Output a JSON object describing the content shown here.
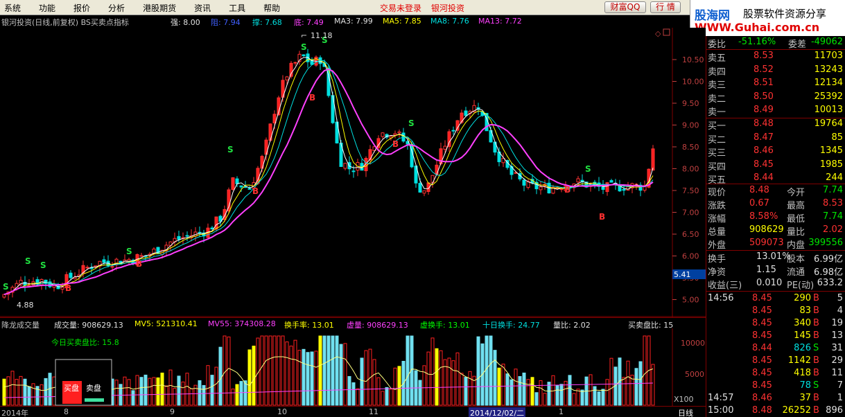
{
  "menu": [
    "系统",
    "功能",
    "报价",
    "分析",
    "港股期货",
    "资讯",
    "工具",
    "帮助"
  ],
  "center_status": [
    "交易未登录",
    "银河投资"
  ],
  "buttons": {
    "caifu": "财富QQ",
    "hangqing": "行 情"
  },
  "logo": {
    "line1": "股海网",
    "line1b": "股票软件资源分享",
    "line2": "WWW.Guhai.com.cn"
  },
  "header": {
    "title": "银河投资(日线,前复权) BS买卖点指标",
    "qiang": "强: 8.00",
    "zu": "阻: 7.94",
    "cheng": "撑: 7.68",
    "di": "底: 7.49",
    "ma3": "MA3: 7.99",
    "ma5": "MA5: 7.85",
    "ma8": "MA8: 7.76",
    "ma13": "MA13: 7.72"
  },
  "vol_header": {
    "name": "降龙成交量",
    "cjl": "成交量: 908629.13",
    "mv5": "MV5: 521310.41",
    "mv55": "MV55: 374308.28",
    "hsl": "换手率: 13.01",
    "xl": "虚量: 908629.13",
    "xhs": "虚换手: 13.01",
    "sr": "十日换手: 24.77",
    "lb": "量比: 2.02",
    "mmb": "买卖盘比: 15",
    "today": "今日买卖盘比: 15.8",
    "buy": "买盘",
    "sell": "卖盘"
  },
  "annotations": {
    "high": "11.18",
    "low": "4.88"
  },
  "y_ticks": [
    "10.50",
    "10.00",
    "9.50",
    "9.00",
    "8.50",
    "8.00",
    "7.50",
    "7.00",
    "6.50",
    "6.00",
    "5.50",
    "5.00"
  ],
  "y_current": "5.41",
  "vol_ticks": [
    "10000",
    "5000"
  ],
  "vol_unit": "X100",
  "x_labels": [
    "2014年",
    "8",
    "9",
    "10",
    "11",
    "2014/12/02/二",
    "1"
  ],
  "period": "日线",
  "quote": {
    "wb_label": "委比",
    "wb": "-51.16%",
    "wc_label": "委差",
    "wc": "-49062",
    "asks": [
      {
        "label": "卖五",
        "price": "8.53",
        "vol": "11703"
      },
      {
        "label": "卖四",
        "price": "8.52",
        "vol": "13243"
      },
      {
        "label": "卖三",
        "price": "8.51",
        "vol": "12134"
      },
      {
        "label": "卖二",
        "price": "8.50",
        "vol": "25392"
      },
      {
        "label": "卖一",
        "price": "8.49",
        "vol": "10013"
      }
    ],
    "bids": [
      {
        "label": "买一",
        "price": "8.48",
        "vol": "19764"
      },
      {
        "label": "买二",
        "price": "8.47",
        "vol": "85"
      },
      {
        "label": "买三",
        "price": "8.46",
        "vol": "1345"
      },
      {
        "label": "买四",
        "price": "8.45",
        "vol": "1985"
      },
      {
        "label": "买五",
        "price": "8.44",
        "vol": "244"
      }
    ],
    "stats": [
      {
        "l1": "现价",
        "v1": "8.48",
        "c1": "up",
        "l2": "今开",
        "v2": "7.74",
        "c2": "dn"
      },
      {
        "l1": "涨跌",
        "v1": "0.67",
        "c1": "up",
        "l2": "最高",
        "v2": "8.53",
        "c2": "up"
      },
      {
        "l1": "涨幅",
        "v1": "8.58%",
        "c1": "up",
        "l2": "最低",
        "v2": "7.74",
        "c2": "dn"
      },
      {
        "l1": "总量",
        "v1": "908629",
        "c1": "yl",
        "l2": "量比",
        "v2": "2.02",
        "c2": "up"
      },
      {
        "l1": "外盘",
        "v1": "509073",
        "c1": "up",
        "l2": "内盘",
        "v2": "399556",
        "c2": "dn"
      }
    ],
    "stats2": [
      {
        "l1": "换手",
        "v1": "13.01%",
        "l2": "股本",
        "v2": "6.99亿"
      },
      {
        "l1": "净资",
        "v1": "1.15",
        "l2": "流通",
        "v2": "6.98亿"
      },
      {
        "l1": "收益(三)",
        "v1": "0.010",
        "l2": "PE(动)",
        "v2": "633.2"
      }
    ],
    "ticks": [
      {
        "time": "14:56",
        "price": "8.45",
        "vol": "290",
        "bs": "B",
        "n": "5"
      },
      {
        "time": "",
        "price": "8.45",
        "vol": "83",
        "bs": "B",
        "n": "4"
      },
      {
        "time": "",
        "price": "8.45",
        "vol": "340",
        "bs": "B",
        "n": "19"
      },
      {
        "time": "",
        "price": "8.45",
        "vol": "145",
        "bs": "B",
        "n": "13"
      },
      {
        "time": "",
        "price": "8.44",
        "vol": "826",
        "bs": "S",
        "n": "31"
      },
      {
        "time": "",
        "price": "8.45",
        "vol": "1142",
        "bs": "B",
        "n": "29"
      },
      {
        "time": "",
        "price": "8.45",
        "vol": "418",
        "bs": "B",
        "n": "11"
      },
      {
        "time": "",
        "price": "8.45",
        "vol": "78",
        "bs": "S",
        "n": "7"
      },
      {
        "time": "14:57",
        "price": "8.46",
        "vol": "37",
        "bs": "B",
        "n": "1"
      },
      {
        "time": "15:00",
        "price": "8.48",
        "vol": "26252",
        "bs": "B",
        "n": "896"
      }
    ]
  },
  "colors": {
    "up": "#ff3232",
    "down": "#00e0e0",
    "ma3": "#ffffff",
    "ma5": "#ffff00",
    "ma8": "#00e0e0",
    "ma13": "#ff40ff"
  }
}
